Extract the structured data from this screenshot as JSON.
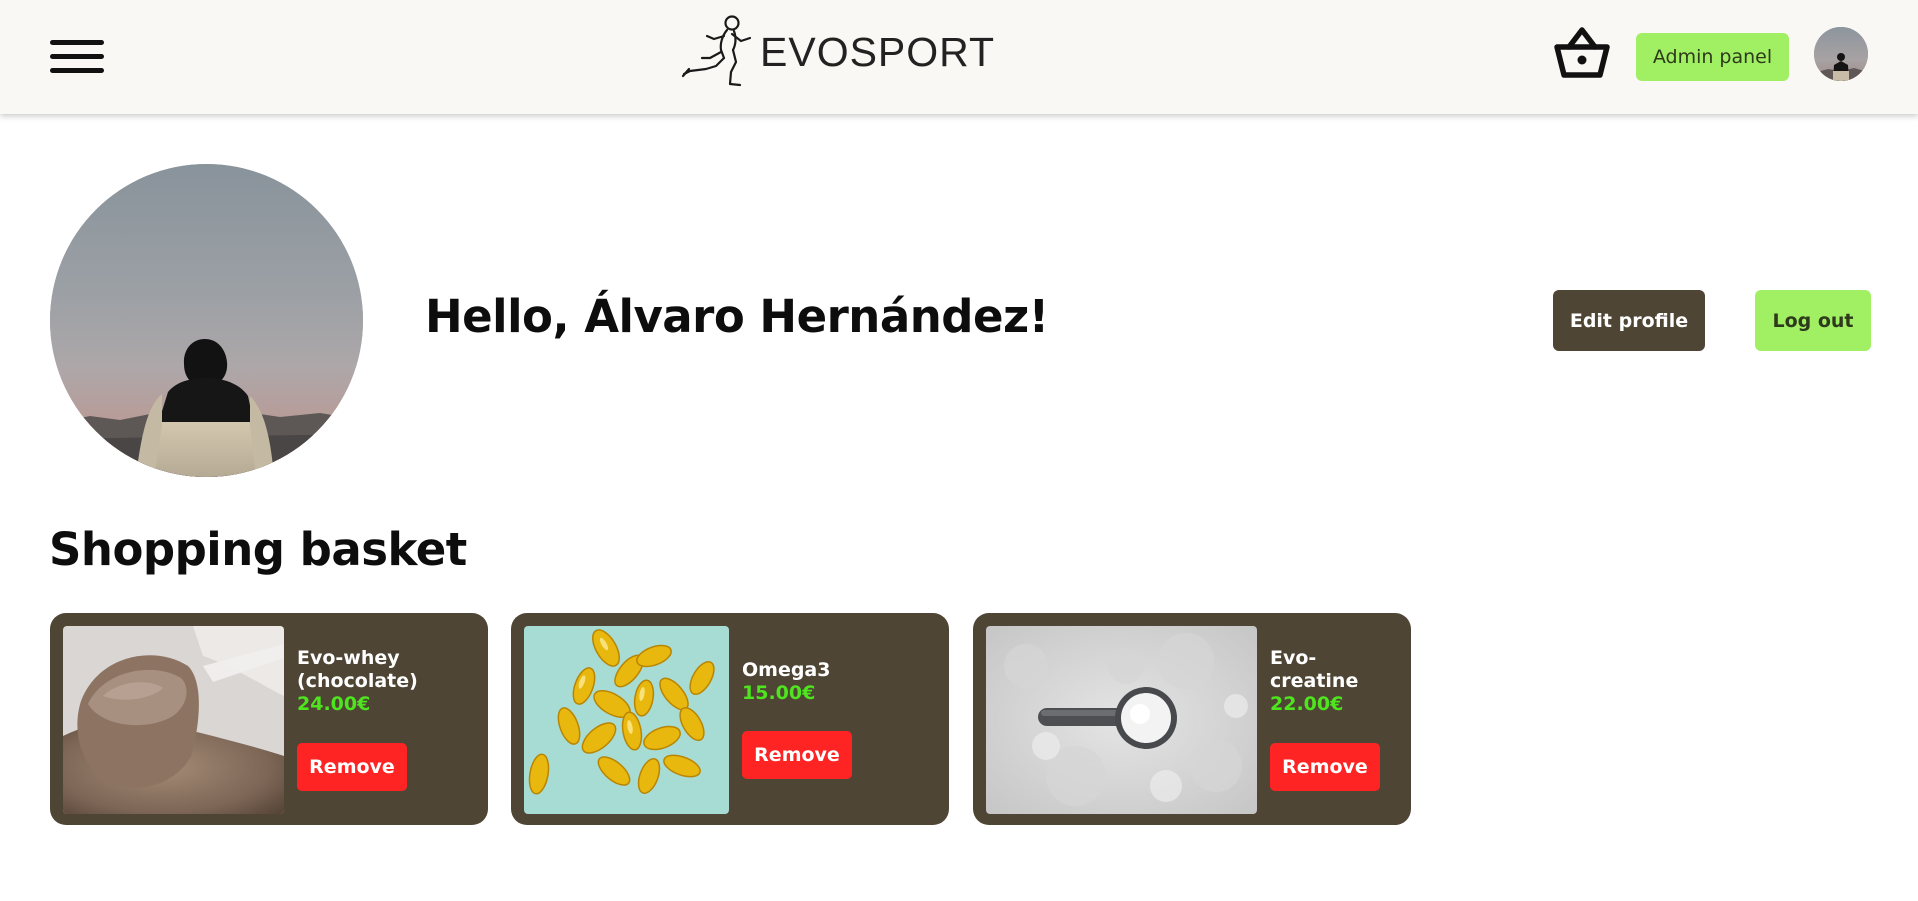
{
  "header": {
    "brand_name": "EVOSPORT",
    "admin_label": "Admin panel"
  },
  "profile": {
    "greeting": "Hello, Álvaro Hernández!",
    "edit_label": "Edit profile",
    "logout_label": "Log out"
  },
  "basket": {
    "title": "Shopping basket",
    "items": [
      {
        "name": "Evo-whey (chocolate)",
        "price": "24.00€",
        "remove_label": "Remove",
        "image": "chocolate-protein-powder-scoop"
      },
      {
        "name": "Omega3",
        "price": "15.00€",
        "remove_label": "Remove",
        "image": "omega3-softgel-capsules"
      },
      {
        "name": "Evo-creatine",
        "price": "22.00€",
        "remove_label": "Remove",
        "image": "creatine-powder-scoop"
      }
    ]
  },
  "colors": {
    "accent_green": "#a1ef63",
    "card_brown": "#4f4535",
    "price_green": "#4ee51e",
    "remove_red": "#ff2424",
    "header_bg": "#faf8f5"
  },
  "icons": {
    "menu": "hamburger-menu-icon",
    "logo": "running-man-logo-icon",
    "basket": "shopping-basket-icon",
    "avatar": "user-avatar"
  }
}
